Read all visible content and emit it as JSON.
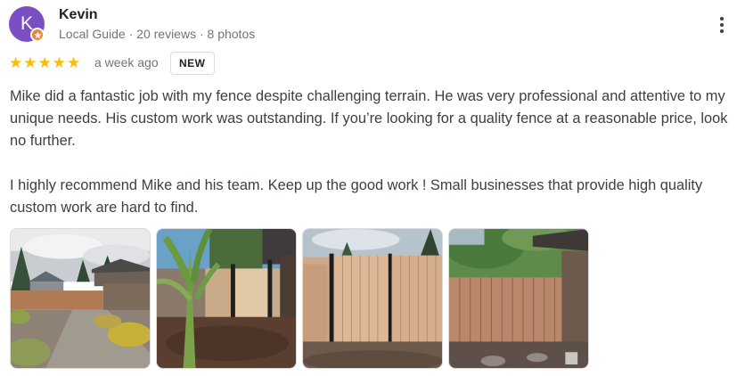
{
  "reviewer": {
    "avatar_initial": "K",
    "avatar_color": "#7b4fc4",
    "name": "Kevin",
    "meta": "Local Guide · 20 reviews · 8 photos",
    "badge_icon": "local-guide-star-icon"
  },
  "rating": {
    "stars": 5,
    "max": 5,
    "color": "#fbbc04"
  },
  "time_ago": "a week ago",
  "badge": "NEW",
  "review": {
    "paragraphs": [
      "Mike did a fantastic job with my fence despite challenging terrain. He was very professional and attentive to my unique needs. His custom work was outstanding. If you’re looking for a quality fence at a reasonable price, look no further.",
      "I highly recommend Mike and his team. Keep up the good work ! Small businesses that provide high quality custom work are hard to find."
    ]
  },
  "photos": [
    {
      "subject": "backyard-fence-garden-photo"
    },
    {
      "subject": "fence-gate-with-banana-plant-photo"
    },
    {
      "subject": "double-gate-fence-photo"
    },
    {
      "subject": "fence-corner-with-shed-photo"
    }
  ],
  "menu_icon": "more-vert-icon"
}
